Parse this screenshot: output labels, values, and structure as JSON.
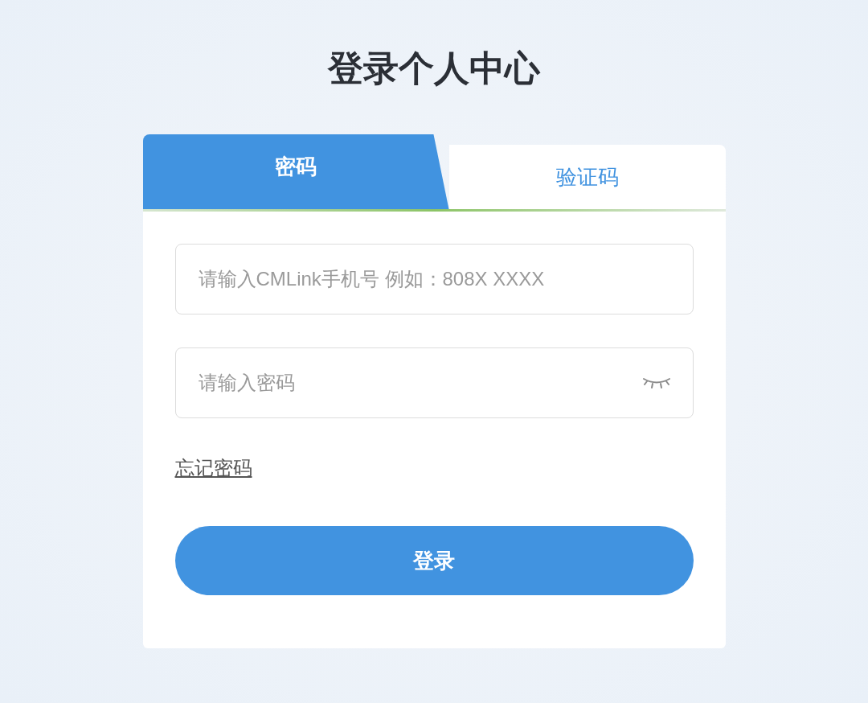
{
  "title": "登录个人中心",
  "tabs": [
    {
      "label": "密码",
      "selected": true
    },
    {
      "label": "验证码",
      "selected": false
    }
  ],
  "fields": [
    {
      "kind": "phone",
      "placeholder": "请输入CMLink手机号 例如：808X XXXX"
    },
    {
      "kind": "password",
      "placeholder": "请输入密码"
    }
  ],
  "forgot_link": "忘记密码",
  "submit_button": "登录"
}
